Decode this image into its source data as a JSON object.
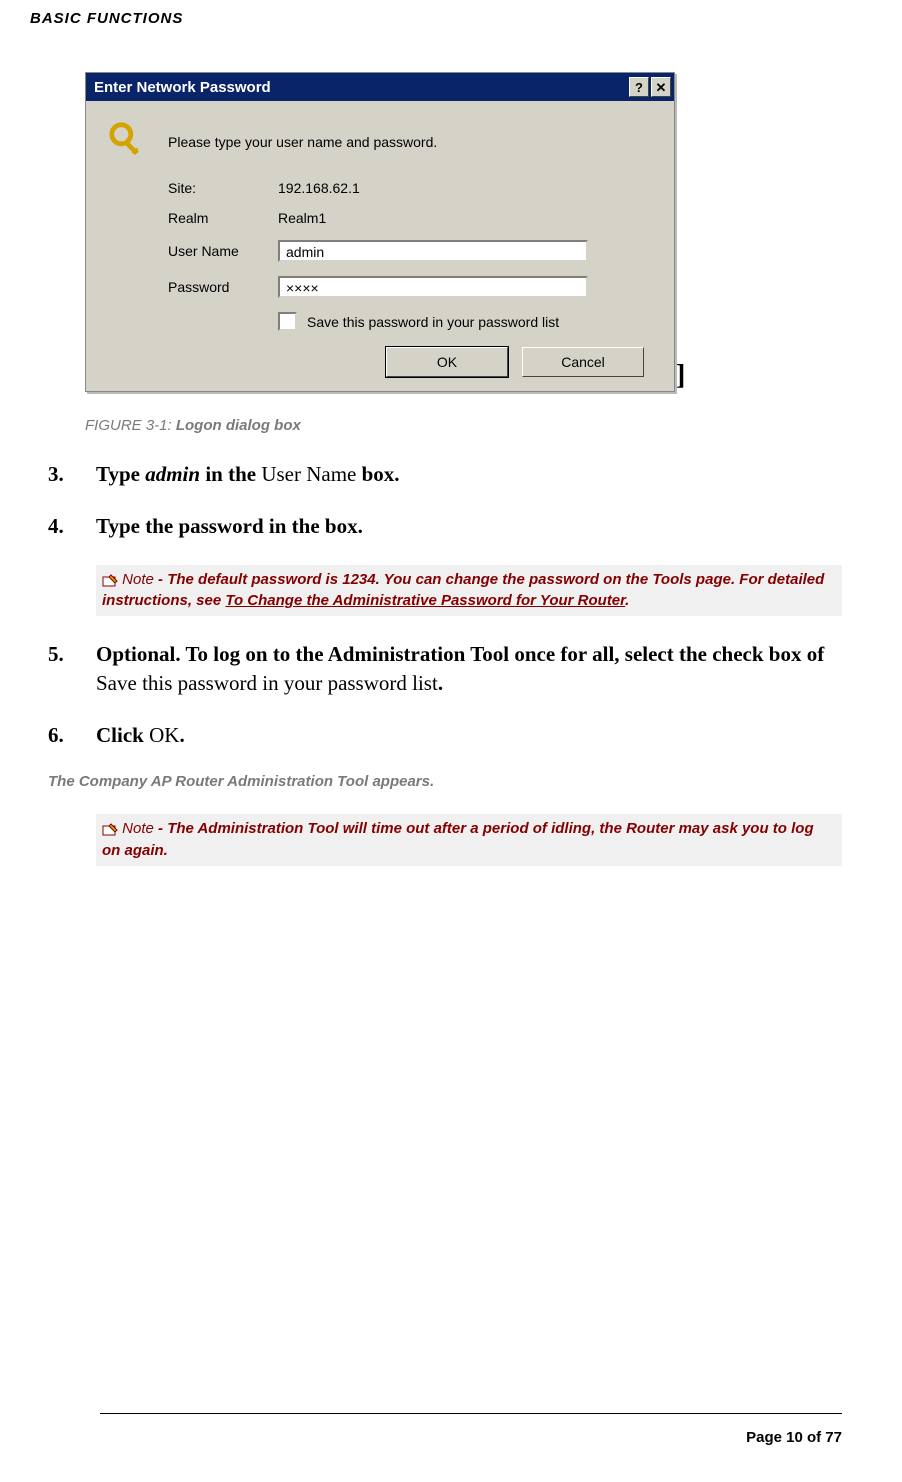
{
  "header": "BASIC FUNCTIONS",
  "dialog": {
    "title": "Enter Network Password",
    "help_btn": "?",
    "close_btn": "✕",
    "intro": "Please type your user name and password.",
    "site_label": "Site:",
    "site_value": "192.168.62.1",
    "realm_label": "Realm",
    "realm_value": "Realm1",
    "user_label": "User Name",
    "user_value": "admin",
    "pass_label": "Password",
    "pass_value": "××××",
    "save_label": "Save this password in your password list",
    "ok": "OK",
    "cancel": "Cancel"
  },
  "figure": {
    "num": "FIGURE 3-1: ",
    "title": "Logon dialog box"
  },
  "steps": {
    "s3": {
      "num": "3.",
      "p1": "Type ",
      "p2": "admin",
      "p3": " in the ",
      "p4": "User Name ",
      "p5": "box."
    },
    "s4": {
      "num": "4.",
      "text": "Type the password in the box."
    },
    "s5": {
      "num": "5.",
      "p1": "Optional. To log on to the Administration Tool once for all, select the check box of ",
      "p2": "Save this password in your password list",
      "p3": "."
    },
    "s6": {
      "num": "6.",
      "p1": "Click ",
      "p2": "OK",
      "p3": "."
    }
  },
  "note1": {
    "label": " Note ",
    "p1": "- The default password is ",
    "p2": "1234",
    "p3": ". You can change the password on the Tools page. For detailed instructions, see ",
    "link": "To Change the Administrative Password for Your Router",
    "p4": "."
  },
  "result": "The Company AP Router Administration Tool appears.",
  "note2": {
    "label": " Note ",
    "text": "- The Administration Tool will time out after a period of idling, the Router may ask you to log on again."
  },
  "footer": "Page 10 of 77"
}
